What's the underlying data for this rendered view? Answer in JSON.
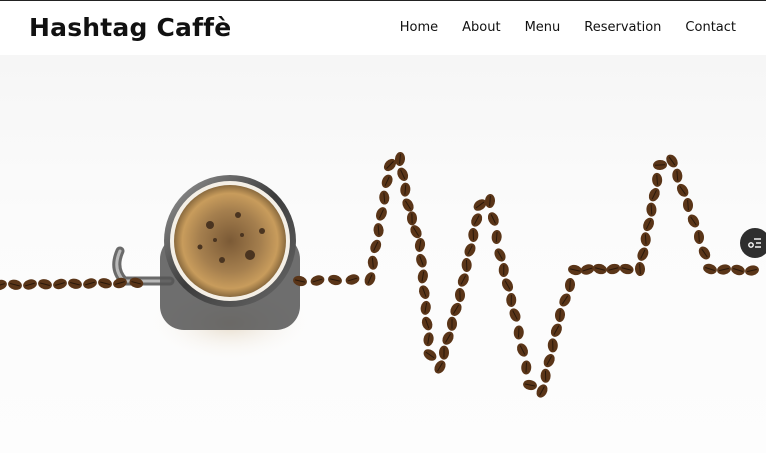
{
  "brand": {
    "title": "Hashtag Caffè"
  },
  "nav": {
    "items": [
      {
        "label": "Home"
      },
      {
        "label": "About"
      },
      {
        "label": "Menu"
      },
      {
        "label": "Reservation"
      },
      {
        "label": "Contact"
      }
    ]
  },
  "hero": {
    "image": "coffee-cup-with-bean-heartbeat-line"
  },
  "side_button": {
    "icon": "settings-list-icon"
  },
  "colors": {
    "accent": "#111111",
    "bean": "#5a3518",
    "side_button": "#2e2e2e"
  }
}
